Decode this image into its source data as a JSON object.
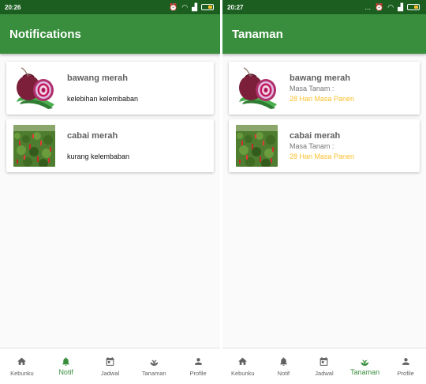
{
  "colors": {
    "statusbar": "#1b5e20",
    "appbar": "#388e3c",
    "accent": "#388e3c",
    "harvest_text": "#fbc02d",
    "battery": "#fbc02d"
  },
  "left": {
    "time": "20:26",
    "title": "Notifications",
    "cards": [
      {
        "image": "red-onion",
        "name": "bawang merah",
        "message": "kelebihan kelembaban"
      },
      {
        "image": "chili-field",
        "name": "cabai merah",
        "message": "kurang kelembaban"
      }
    ],
    "nav": [
      {
        "icon": "home-icon",
        "label": "Kebunku"
      },
      {
        "icon": "bell-icon",
        "label": "Notif"
      },
      {
        "icon": "calendar-icon",
        "label": "Jadwal"
      },
      {
        "icon": "plant-icon",
        "label": "Tanaman"
      },
      {
        "icon": "person-icon",
        "label": "Profile"
      }
    ],
    "active_nav": "Notif"
  },
  "right": {
    "time": "20:27",
    "status_extra": "...",
    "title": "Tanaman",
    "cards": [
      {
        "image": "red-onion",
        "name": "bawang merah",
        "sub": "Masa Tanam :",
        "harvest": "28 Hari Masa Panen"
      },
      {
        "image": "chili-field",
        "name": "cabai merah",
        "sub": "Masa Tanam :",
        "harvest": "28 Hari Masa Panen"
      }
    ],
    "nav": [
      {
        "icon": "home-icon",
        "label": "Kebunku"
      },
      {
        "icon": "bell-icon",
        "label": "Notif"
      },
      {
        "icon": "calendar-icon",
        "label": "Jadwal"
      },
      {
        "icon": "plant-icon",
        "label": "Tanaman"
      },
      {
        "icon": "person-icon",
        "label": "Profile"
      }
    ],
    "active_nav": "Tanaman"
  }
}
